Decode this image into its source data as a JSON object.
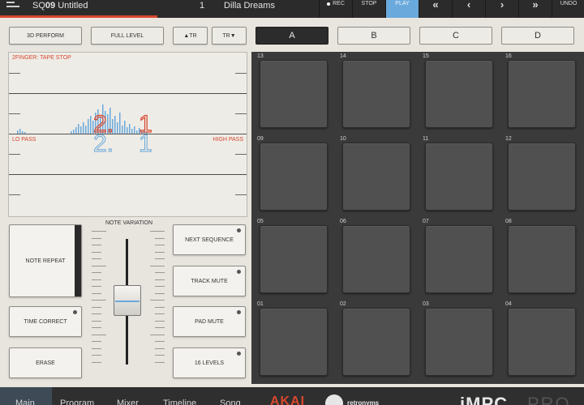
{
  "topbar": {
    "sequence_prefix": "SQ",
    "sequence_number": "09",
    "sequence_title": "Untitled",
    "bar": "1",
    "song": "Dilla Dreams",
    "sequence_progress_fraction": 0.27,
    "transport": [
      {
        "label": "REC",
        "icon": "record-dot"
      },
      {
        "label": "STOP"
      },
      {
        "label": "PLAY",
        "active": true
      },
      {
        "label": "«",
        "icon": "rewind-fast"
      },
      {
        "label": "‹",
        "icon": "step-back"
      },
      {
        "label": "›",
        "icon": "step-forward"
      },
      {
        "label": "»",
        "icon": "forward-fast"
      },
      {
        "label": "UNDO"
      }
    ]
  },
  "controls": {
    "perform": "3D PERFORM",
    "full_level": "FULL LEVEL",
    "tr_up": "▲TR",
    "tr_down": "TR▼",
    "banks": [
      "A",
      "B",
      "C",
      "D"
    ],
    "active_bank": "A"
  },
  "xy": {
    "hint": "2FINGER: TAPE STOP",
    "lo": "LO PASS",
    "hi": "HIGH PASS",
    "value_a": "2.",
    "value_b": "1"
  },
  "left_buttons": {
    "note_repeat": "NOTE REPEAT",
    "time_correct": "TIME CORRECT",
    "erase": "ERASE",
    "note_variation": "NOTE VARIATION",
    "next_sequence": "NEXT SEQUENCE",
    "track_mute": "TRACK MUTE",
    "pad_mute": "PAD MUTE",
    "sixteen_levels": "16 LEVELS"
  },
  "pads": [
    [
      "13",
      "14",
      "15",
      "16"
    ],
    [
      "09",
      "10",
      "11",
      "12"
    ],
    [
      "05",
      "06",
      "07",
      "08"
    ],
    [
      "01",
      "02",
      "03",
      "04"
    ]
  ],
  "bottombar": {
    "tabs": [
      "Main",
      "Program",
      "Mixer",
      "Timeline",
      "Song"
    ],
    "active_tab": "Main",
    "brand": "AKAI",
    "partner": "retronyms",
    "app": "iMPC",
    "edition": "PRO"
  },
  "colors": {
    "accent_red": "#d8472f",
    "accent_blue": "#6aa9dc",
    "pad": "#505050"
  }
}
